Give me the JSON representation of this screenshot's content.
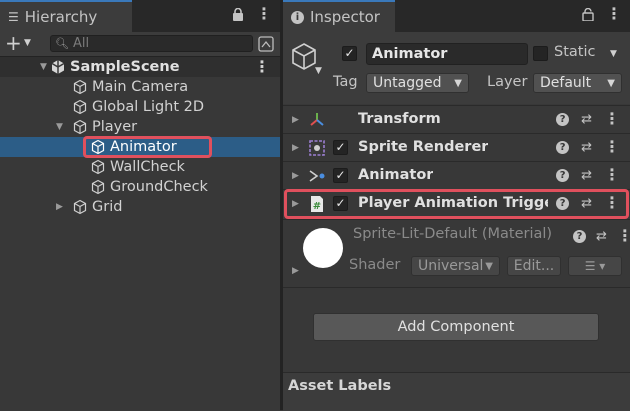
{
  "hierarchy": {
    "tab_title": "Hierarchy",
    "search_placeholder": "All",
    "scene": "SampleScene",
    "items": [
      {
        "label": "Main Camera"
      },
      {
        "label": "Global Light 2D"
      },
      {
        "label": "Player"
      },
      {
        "label": "Animator"
      },
      {
        "label": "WallCheck"
      },
      {
        "label": "GroundCheck"
      },
      {
        "label": "Grid"
      }
    ]
  },
  "inspector": {
    "tab_title": "Inspector",
    "object_name": "Animator",
    "static_label": "Static",
    "tag_label": "Tag",
    "tag_value": "Untagged",
    "layer_label": "Layer",
    "layer_value": "Default",
    "components": [
      {
        "name": "Transform"
      },
      {
        "name": "Sprite Renderer"
      },
      {
        "name": "Animator"
      },
      {
        "name": "Player Animation Triggers"
      }
    ],
    "material": {
      "name": "Sprite-Lit-Default (Material)",
      "shader_label": "Shader",
      "shader_value": "Universal",
      "edit_label": "Edit..."
    },
    "add_component": "Add Component",
    "asset_labels": "Asset Labels"
  },
  "colors": {
    "selection": "#2c5d87",
    "highlight": "#e0505d",
    "tab_accent": "#3a79bb"
  }
}
